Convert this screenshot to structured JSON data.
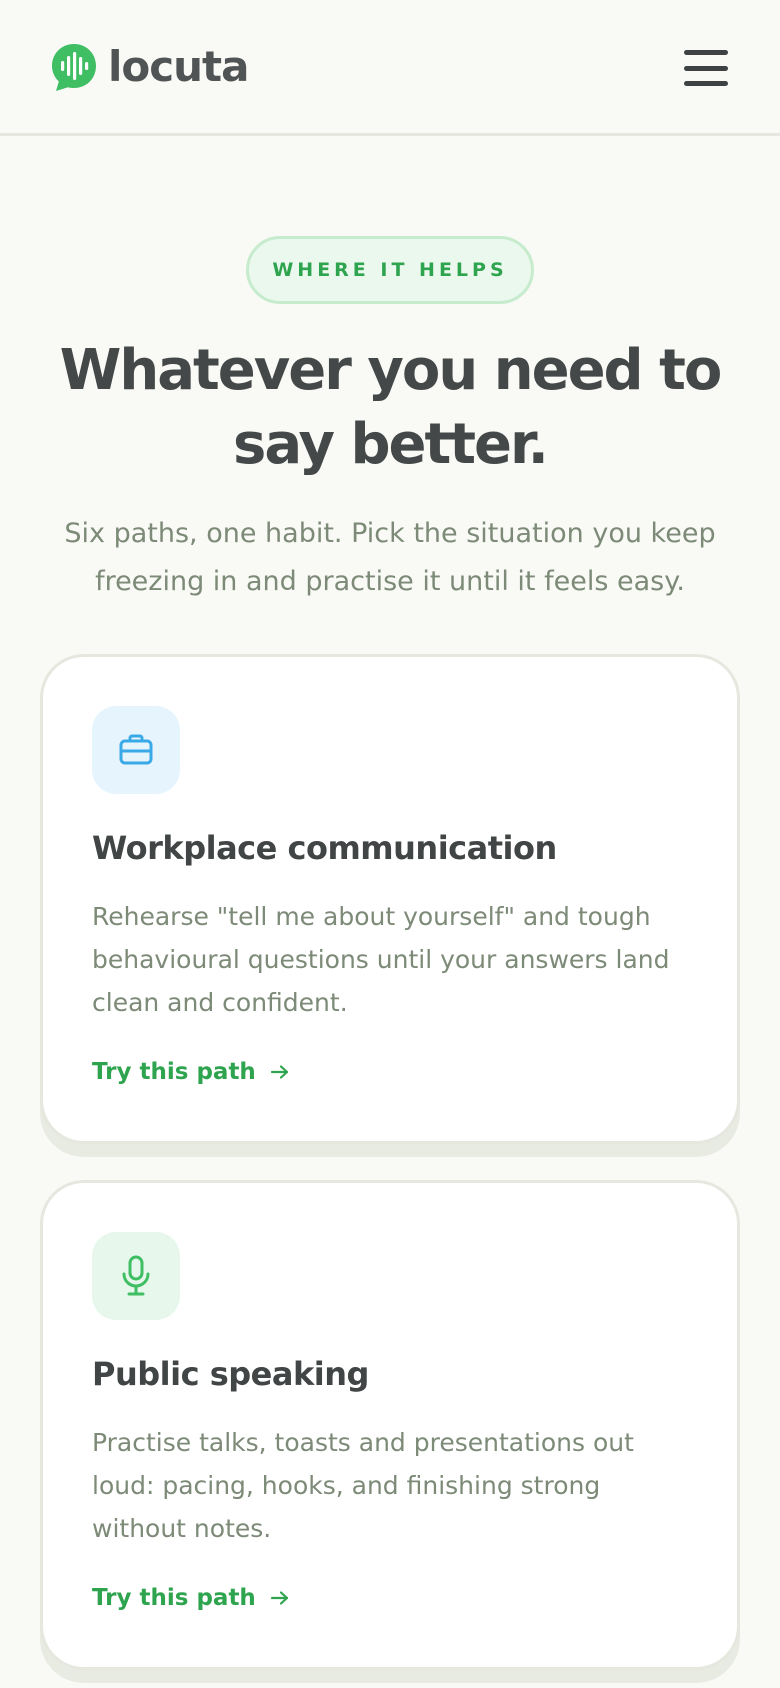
{
  "header": {
    "logo_text": "locuta",
    "logo_icon": "sound-wave-bubble-icon",
    "menu_icon": "hamburger-menu-icon"
  },
  "hero": {
    "eyebrow": "WHERE IT HELPS",
    "headline": "Whatever you need to say better.",
    "subtitle": "Six paths, one habit. Pick the situation you keep freezing in and practise it until it feels easy."
  },
  "cards": [
    {
      "icon": "briefcase-icon",
      "title": "Workplace communication",
      "description": "Rehearse \"tell me about yourself\" and tough behavioural questions until your answers land clean and confident.",
      "link": "Try this path"
    },
    {
      "icon": "microphone-icon",
      "title": "Public speaking",
      "description": "Practise talks, toasts and presentations out loud: pacing, hooks, and finishing strong without notes.",
      "link": "Try this path"
    }
  ],
  "colors": {
    "background": "#f9faf6",
    "brand_green": "#2fa44f",
    "text_dark": "#454848",
    "text_muted": "#7c8a77",
    "icon_blue": "#3aa9e8",
    "icon_green": "#3fbe63"
  }
}
